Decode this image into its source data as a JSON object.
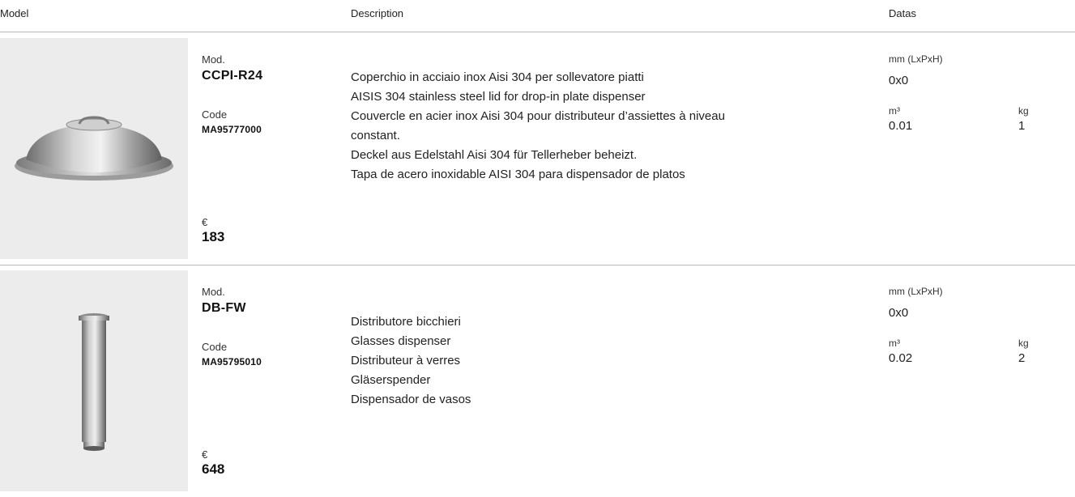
{
  "header": {
    "model": "Model",
    "description": "Description",
    "datas": "Datas"
  },
  "products": [
    {
      "image": "stainless-steel-dome-lid",
      "mod_label": "Mod.",
      "model": "CCPI-R24",
      "code_label": "Code",
      "code": "MA95777000",
      "currency": "€",
      "price": "183",
      "description": [
        "Coperchio in acciaio inox Aisi 304 per sollevatore piatti",
        "AISIS 304 stainless steel lid for drop-in plate dispenser",
        "Couvercle en acier inox Aisi 304 pour distributeur d’assiettes à niveau",
        "constant.",
        "Deckel aus Edelstahl Aisi 304 für Tellerheber beheizt.",
        "Tapa de acero inoxidable AISI 304 para dispensador de platos"
      ],
      "dims_label": "mm (LxPxH)",
      "dims": "0x0",
      "volume_label": "m³",
      "volume": "0.01",
      "weight_label": "kg",
      "weight": "1"
    },
    {
      "image": "cylindrical-glasses-dispenser",
      "mod_label": "Mod.",
      "model": "DB-FW",
      "code_label": "Code",
      "code": "MA95795010",
      "currency": "€",
      "price": "648",
      "description": [
        "Distributore bicchieri",
        "Glasses dispenser",
        "Distributeur à verres",
        "Gläserspender",
        "Dispensador de vasos"
      ],
      "dims_label": "mm (LxPxH)",
      "dims": "0x0",
      "volume_label": "m³",
      "volume": "0.02",
      "weight_label": "kg",
      "weight": "2"
    }
  ]
}
